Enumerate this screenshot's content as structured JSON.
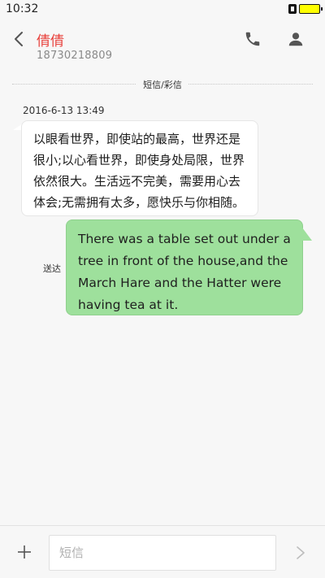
{
  "status_bar": {
    "time": "10:32",
    "battery_color": "#ffff00"
  },
  "header": {
    "contact_name": "倩倩",
    "contact_number": "18730218809",
    "back_icon": "chevron-left-icon",
    "call_icon": "phone-icon",
    "contact_icon": "person-icon",
    "accent_color": "#e8423d"
  },
  "thread": {
    "channel_label": "短信/彩信",
    "timestamp": "2016-6-13 13:49",
    "messages": [
      {
        "direction": "incoming",
        "lines": [
          "以眼看世界，即使站的最高，世界还是",
          "很小;以心看世界，即使身处局限，世界",
          "依然很大。生活远不完美，需要用心去",
          "体会;无需拥有太多，愿快乐与你相随。"
        ]
      },
      {
        "direction": "outgoing",
        "lines": [
          "There was a table set out under a",
          "tree in front of the house,and the",
          "March Hare and the Hatter were",
          "having tea at it."
        ],
        "status": "送达",
        "bubble_color": "#9ee09c"
      }
    ]
  },
  "composer": {
    "add_icon": "plus-icon",
    "placeholder": "短信",
    "value": "",
    "send_icon": "send-arrow-icon"
  }
}
